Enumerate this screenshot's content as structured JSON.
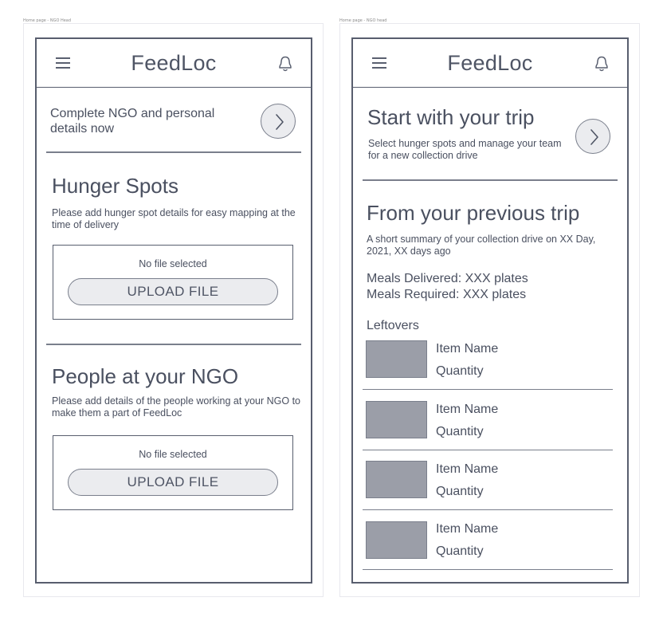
{
  "frame_labels": {
    "left": "Home page - NGO Head",
    "right": "Home page - NGO head"
  },
  "app": {
    "title": "FeedLoc",
    "menu_icon": "hamburger-menu-icon",
    "notification_icon": "bell-icon",
    "next_icon": "chevron-right-icon"
  },
  "left_screen": {
    "complete_banner": "Complete NGO and personal details now",
    "hunger_spots": {
      "heading": "Hunger Spots",
      "description": "Please add hunger spot details for easy mapping at the time of delivery",
      "file_status": "No file selected",
      "upload_label": "UPLOAD FILE"
    },
    "people": {
      "heading": "People at your NGO",
      "description": "Please add details of the people working at your NGO to make them a part of FeedLoc",
      "file_status": "No file selected",
      "upload_label": "UPLOAD FILE"
    }
  },
  "right_screen": {
    "start_trip": {
      "heading": "Start with your trip",
      "description": "Select hunger spots and manage your team for a new collection drive"
    },
    "previous_trip": {
      "heading": "From your previous trip",
      "summary": "A short summary of your collection drive on XX Day, 2021, XX days ago",
      "meals_delivered": "Meals Delivered: XXX plates",
      "meals_required": "Meals Required: XXX plates",
      "leftovers_label": "Leftovers",
      "items": [
        {
          "name": "Item Name",
          "quantity": "Quantity"
        },
        {
          "name": "Item Name",
          "quantity": "Quantity"
        },
        {
          "name": "Item Name",
          "quantity": "Quantity"
        },
        {
          "name": "Item Name",
          "quantity": "Quantity"
        }
      ]
    }
  },
  "colors": {
    "stroke": "#585e6e",
    "text": "#4a5060",
    "placeholder_fill": "#9b9ea8",
    "button_fill": "#ebecef"
  }
}
